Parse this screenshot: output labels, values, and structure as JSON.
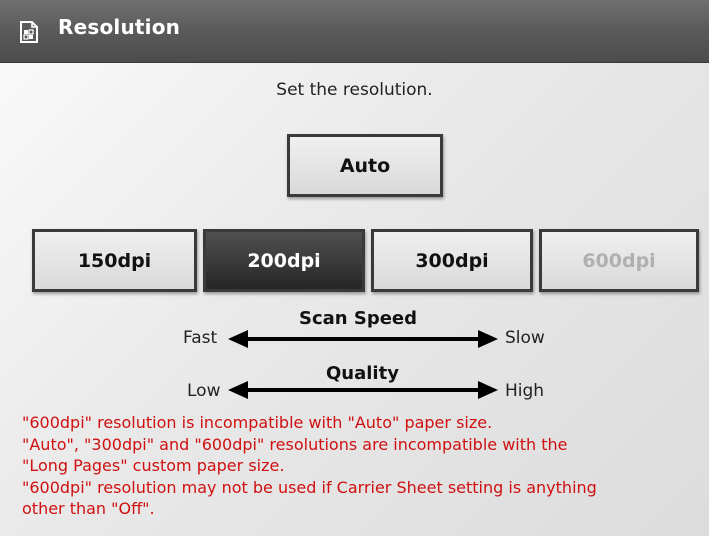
{
  "header": {
    "title": "Resolution",
    "icon": "scanner-settings-icon"
  },
  "prompt": "Set the resolution.",
  "buttons": {
    "auto": "Auto",
    "dpi150": "150dpi",
    "dpi200": "200dpi",
    "dpi300": "300dpi",
    "dpi600": "600dpi",
    "selected": "200dpi",
    "disabled": [
      "600dpi"
    ]
  },
  "scan_speed": {
    "label": "Scan Speed",
    "left": "Fast",
    "right": "Slow"
  },
  "quality": {
    "label": "Quality",
    "left": "Low",
    "right": "High"
  },
  "notes": [
    "\"600dpi\" resolution is incompatible with \"Auto\" paper size.",
    "\"Auto\", \"300dpi\" and \"600dpi\" resolutions are incompatible with the",
    "\"Long Pages\" custom paper size.",
    "\"600dpi\" resolution may not be used if Carrier Sheet setting is anything",
    "other than \"Off\"."
  ],
  "colors": {
    "note_text": "#d01010",
    "selected_bg": "#2e2e2e",
    "titlebar": "#5a5a5a"
  }
}
